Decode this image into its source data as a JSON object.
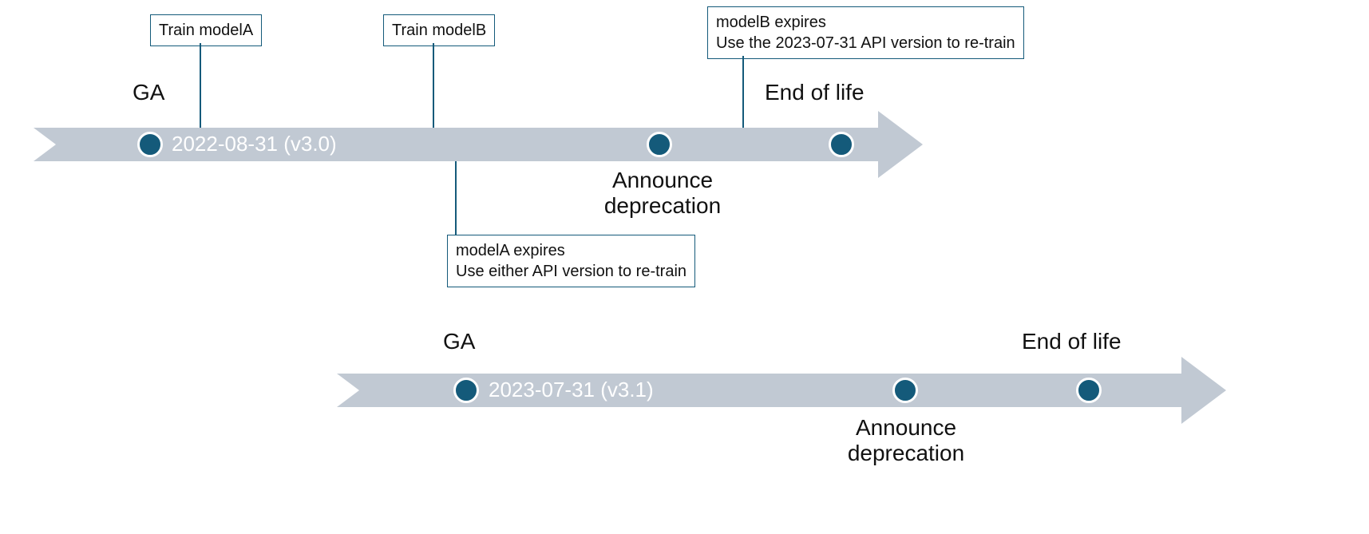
{
  "timeline1": {
    "ga_label": "GA",
    "version_label": "2022-08-31 (v3.0)",
    "announce_label_l1": "Announce",
    "announce_label_l2": "deprecation",
    "eol_label": "End of life",
    "callout_trainA": "Train modelA",
    "callout_trainB": "Train modelB",
    "callout_modelB_expires_l1": "modelB expires",
    "callout_modelB_expires_l2": "Use the 2023-07-31 API version to re-train",
    "callout_modelA_expires_l1": "modelA expires",
    "callout_modelA_expires_l2": "Use either API version to re-train"
  },
  "timeline2": {
    "ga_label": "GA",
    "version_label": "2023-07-31 (v3.1)",
    "announce_label_l1": "Announce",
    "announce_label_l2": "deprecation",
    "eol_label": "End of life"
  }
}
